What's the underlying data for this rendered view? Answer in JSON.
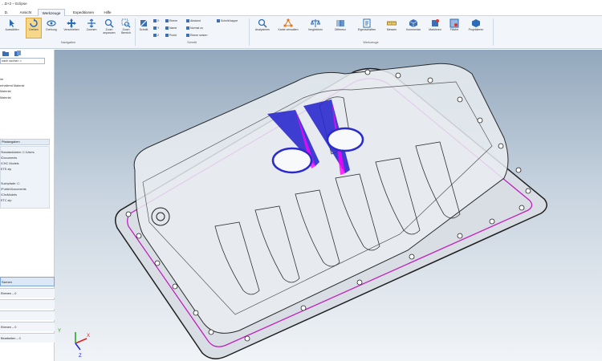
{
  "window": {
    "title": "...D+2 – Eclipse"
  },
  "menu": {
    "tabs": [
      {
        "label": "D."
      },
      {
        "label": "Ansicht"
      },
      {
        "label": "Werkzeuge"
      },
      {
        "label": "Expeditionen"
      },
      {
        "label": "Hilfe"
      }
    ]
  },
  "ribbon": {
    "groups": {
      "navigation": "Navigation",
      "schnitt": "Schnitt",
      "werkzeuge": "Werkzeuge"
    },
    "buttons": {
      "auswaehlen": "Auswählen",
      "drehen": "Drehen",
      "drehung": "Drehung",
      "verschieben": "Verschieben",
      "zoomen": "Zoomen",
      "zoom_anpassen": "Zoom anpassen",
      "zoom_bereich": "Zoom Bereich",
      "schnitt": "Schnitt"
    },
    "schnitt_items": {
      "ebene": "Ebene",
      "name": "Name",
      "punkt": "Punkt",
      "abstand": "Abstand",
      "normal_zu": "Normal zu",
      "ebene_setzen": "Ebene setzen",
      "schnitt_kappe": "Schnitt kappe"
    },
    "tools": {
      "analysieren": "Analysieren",
      "kante_verwalten": "Kante verwalten",
      "vergleichen": "Vergleichen",
      "differenz": "Differenz",
      "eigenschaften": "Eigenschaften",
      "messen": "Messen",
      "kommentar": "Kommentar",
      "markieren": "Markieren",
      "flaeche": "Fläche",
      "projektieren": "Projektieren"
    }
  },
  "left_panel": {
    "search_placeholder": "Suchen …",
    "tree": [
      {
        "label": "nach suchen >"
      },
      {
        "label": "ire"
      },
      {
        "label": "erhaltend Material"
      },
      {
        "label": "Material"
      },
      {
        "label": "Material"
      }
    ],
    "section_title": "Pfadangaben",
    "paths": [
      {
        "label": "Standarddaten: C:\\Users"
      },
      {
        "label": "\\Documents"
      },
      {
        "label": "\\CHC Models"
      },
      {
        "label": "ETE.zip"
      },
      {
        "label": "Suchpfade: C:"
      },
      {
        "label": "\\Public\\Documents"
      },
      {
        "label": "\\ChcModels"
      },
      {
        "label": "ETC.zip"
      }
    ],
    "bottom_rows": [
      {
        "label": "Szenen"
      },
      {
        "label": "Ebenen – 0"
      },
      {
        "label": ""
      },
      {
        "label": ""
      },
      {
        "label": "Ebenen – 0"
      },
      {
        "label": "Bearbeiten – 0"
      }
    ]
  },
  "viewport": {
    "background_top": "#93a8bd",
    "background_bottom": "#f1f4f7",
    "triad": {
      "x": "X",
      "y": "Y",
      "z": "Z"
    }
  },
  "colors": {
    "accent": "#2b6cb8",
    "highlight": "#ff00ff",
    "blue_fill": "#2a2acd"
  }
}
